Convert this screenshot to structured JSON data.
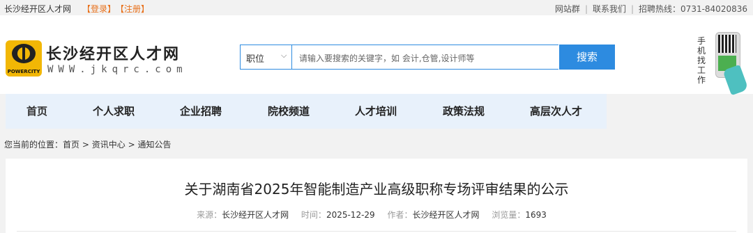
{
  "topbar": {
    "site_name": "长沙经开区人才网",
    "login": "【登录】",
    "register": "【注册】",
    "links": [
      "网站群",
      "联系我们"
    ],
    "hotline": "招聘热线：0731-84020836"
  },
  "header": {
    "logo_text": "POWERCITY",
    "title": "长沙经开区人才网",
    "url": "WWW.jkqrc.com",
    "search": {
      "category": "职位",
      "placeholder": "请输入要搜索的关键字，如 会计,仓管,设计师等",
      "button": "搜索"
    },
    "mobile_label": "手机找工作"
  },
  "nav": {
    "items": [
      "首页",
      "个人求职",
      "企业招聘",
      "院校频道",
      "人才培训",
      "政策法规",
      "高层次人才"
    ]
  },
  "breadcrumb": {
    "prefix": "您当前的位置：",
    "path": [
      "首页",
      "资讯中心",
      "通知公告"
    ],
    "sep": ">"
  },
  "article": {
    "title": "关于湖南省2025年智能制造产业高级职称专场评审结果的公示",
    "source_label": "来源：",
    "source": "长沙经开区人才网",
    "time_label": "时间：",
    "time": "2025-12-29",
    "author_label": "作者：",
    "author": "长沙经开区人才网",
    "views_label": "浏览量：",
    "views": "1693"
  }
}
